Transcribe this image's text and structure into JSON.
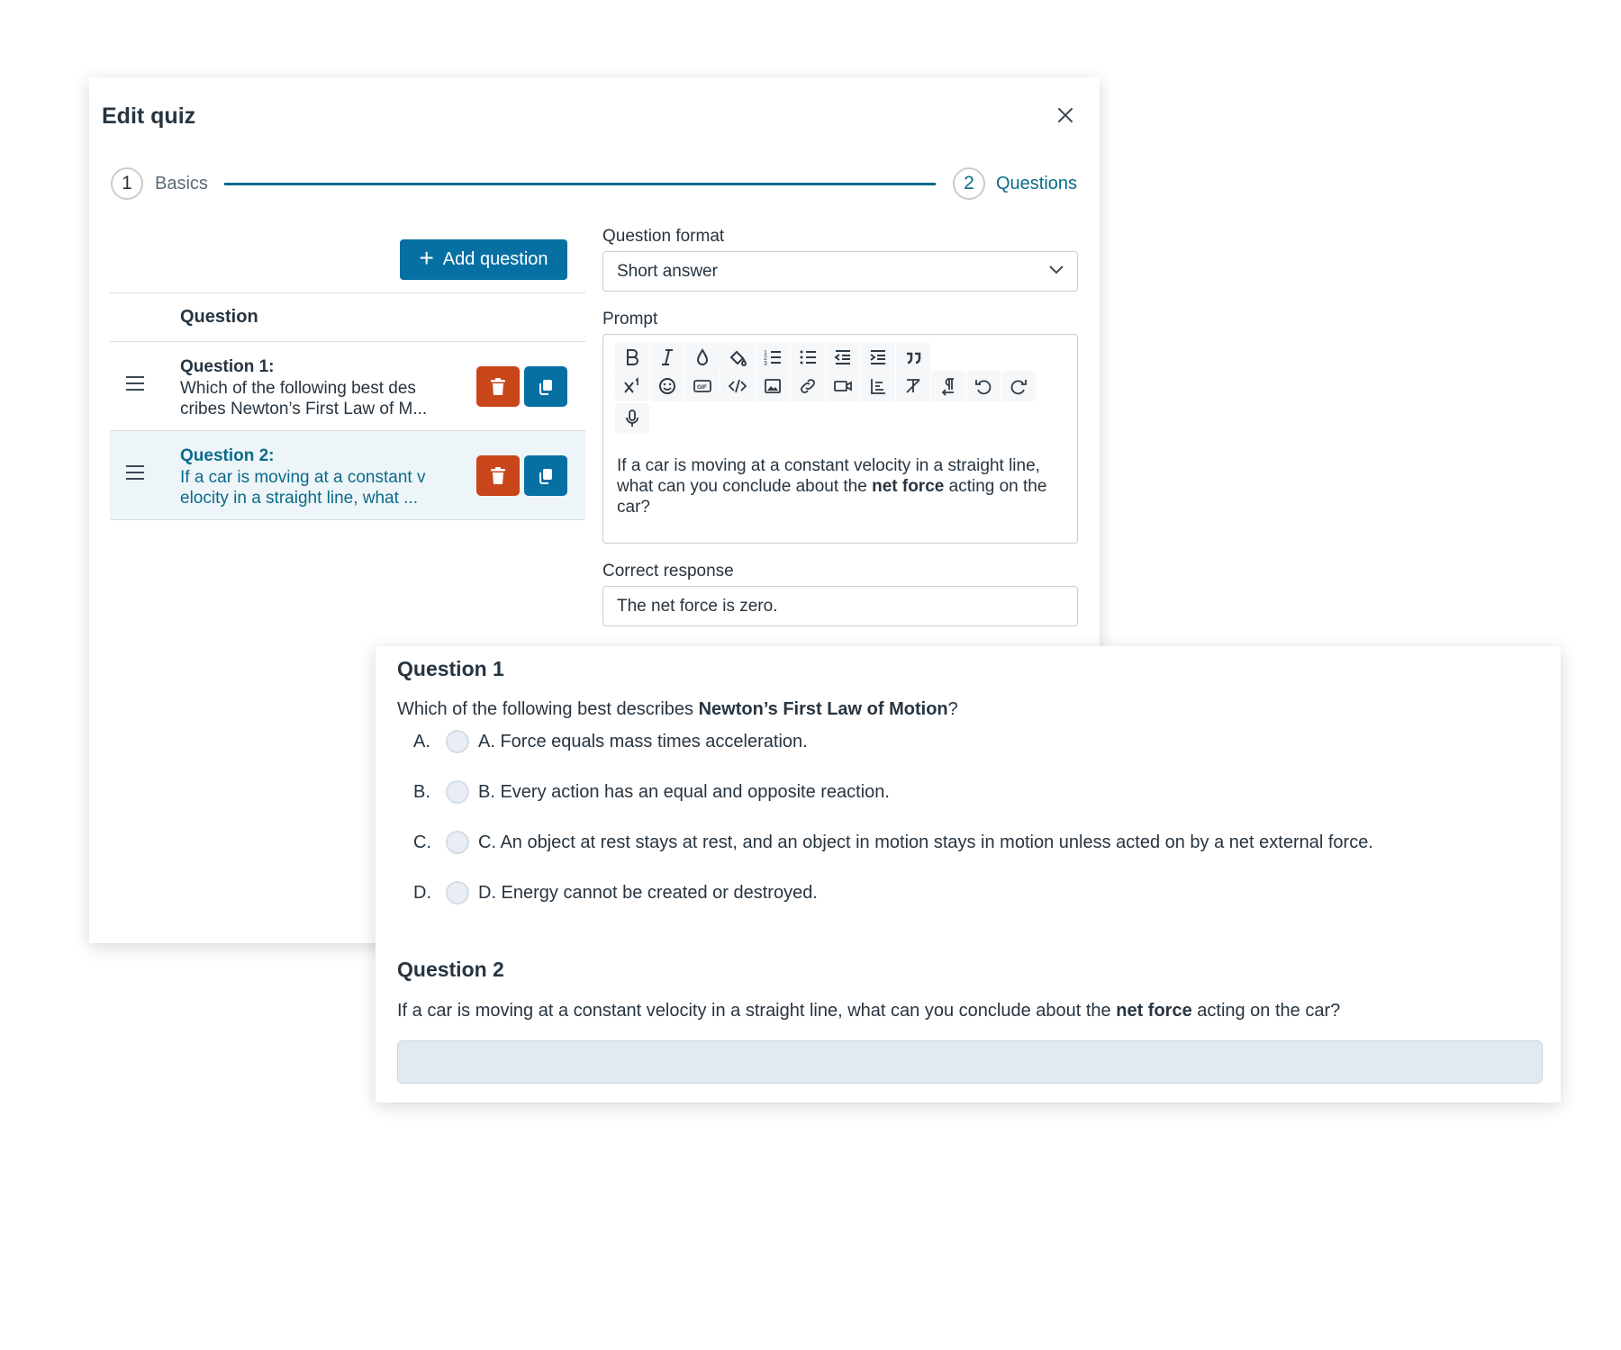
{
  "modal": {
    "title": "Edit quiz",
    "stepper": [
      {
        "number": "1",
        "label": "Basics"
      },
      {
        "number": "2",
        "label": "Questions"
      }
    ],
    "add_question_label": "Add question",
    "list_header": "Question",
    "questions": [
      {
        "title": "Question 1:",
        "snippet": "Which of the following best des cribes Newton’s First Law of M..."
      },
      {
        "title": "Question 2:",
        "snippet": "If a car is moving at a constant v elocity in a straight line, what ..."
      }
    ],
    "question_format_label": "Question format",
    "question_format_value": "Short answer",
    "prompt_label": "Prompt",
    "prompt": {
      "before": "If a car is moving at a constant velocity in a straight line, what can you conclude about the ",
      "bold": "net force",
      "after": " acting on the car?"
    },
    "correct_response_label": "Correct response",
    "correct_response_value": "The net force is zero."
  },
  "preview": {
    "q1": {
      "title": "Question 1",
      "text_before": "Which of the following best describes ",
      "text_bold": "Newton’s First Law of Motion",
      "text_after": "?",
      "choices": [
        {
          "letter": "A.",
          "text": "A. Force equals mass times acceleration."
        },
        {
          "letter": "B.",
          "text": "B. Every action has an equal and opposite reaction."
        },
        {
          "letter": "C.",
          "text": "C. An object at rest stays at rest, and an object in motion stays in motion unless acted on by a net external force."
        },
        {
          "letter": "D.",
          "text": "D. Energy cannot be created or destroyed."
        }
      ]
    },
    "q2": {
      "title": "Question 2",
      "text_before": "If a car is moving at a constant velocity in a straight line, what can you conclude about the ",
      "text_bold": "net force",
      "text_after": " acting on the car?",
      "answer_value": ""
    }
  },
  "colors": {
    "primary": "#0770a3",
    "danger": "#c9451a",
    "accent_text": "#0a6b8a",
    "text": "#273540"
  },
  "icons": {
    "close": "close-icon",
    "add": "plus-icon",
    "drag": "drag-handle-icon",
    "delete": "trash-icon",
    "duplicate": "copy-icon",
    "dropdown": "chevron-down-icon",
    "toolbar": [
      "bold-icon",
      "italic-icon",
      "text-color-icon",
      "background-color-icon",
      "ordered-list-icon",
      "bullet-list-icon",
      "outdent-icon",
      "indent-icon",
      "quote-icon",
      "superscript-icon",
      "emoji-icon",
      "gif-icon",
      "code-icon",
      "image-icon",
      "link-icon",
      "video-icon",
      "align-icon",
      "clear-format-icon",
      "paragraph-direction-icon",
      "undo-icon",
      "redo-icon",
      "microphone-icon"
    ]
  }
}
